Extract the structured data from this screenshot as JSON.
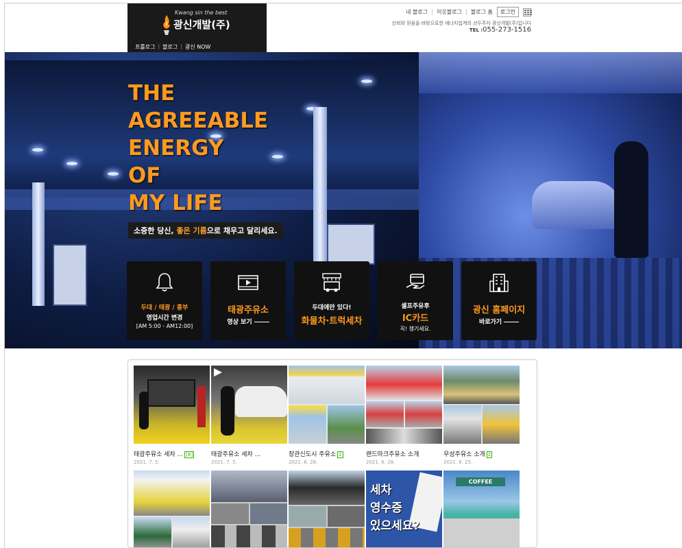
{
  "header": {
    "logo_sub": "Kwang sin the best",
    "logo_title": "광신개발(주)",
    "logo_nav": [
      "프롤로그",
      "블로그",
      "광신 NOW"
    ],
    "top_links": [
      "내 블로그",
      "이웃블로그",
      "블로그 홈"
    ],
    "login": "로그인",
    "tagline": "신뢰와 믿음을 바탕으로한 에너지업계의 선두주자 광신개발(주)입니다",
    "tel_label": "TEL :",
    "tel": "055-273-1516"
  },
  "hero": {
    "headline": [
      "THE",
      "AGREEABLE",
      "ENERGY",
      "OF",
      "MY LIFE"
    ],
    "sub_pre": "소중한 당신, ",
    "sub_em": "좋은 기름",
    "sub_post": "으로 채우고 달리세요.",
    "cards": [
      {
        "icon": "bell-icon",
        "t1": "두대 / 태광 / 흥부",
        "t2": "영업시간 변경",
        "t3": "[AM 5:00 - AM12:00]"
      },
      {
        "icon": "video-icon",
        "big": "태광주유소",
        "t2": "영상 보기"
      },
      {
        "icon": "truck-wash-icon",
        "t2": "두대에만 있다!",
        "big": "화물차·트럭세차"
      },
      {
        "icon": "card-hand-icon",
        "t2": "셀프주유후",
        "big": "IC카드",
        "t3": "꼭! 챙기세요."
      },
      {
        "icon": "building-icon",
        "big": "광신 홈페이지",
        "t2": "바로가기"
      }
    ]
  },
  "blog": {
    "posts": [
      {
        "title": "태광주유소 세차 ...",
        "badge": "[8]",
        "date": "2021. 7. 5."
      },
      {
        "title": "태광주유소 세차 ...",
        "badge": "",
        "date": "2021. 7. 5."
      },
      {
        "title": "창관신도시 주유소",
        "badge": "2",
        "date": "2021. 6. 28."
      },
      {
        "title": "랜드마크주유소 소개",
        "badge": "",
        "date": "2021. 6. 28."
      },
      {
        "title": "우성주유소 소개",
        "badge": "2",
        "date": "2021. 6. 25."
      },
      {
        "title": "",
        "badge": "",
        "date": ""
      },
      {
        "title": "",
        "badge": "",
        "date": ""
      },
      {
        "title": "",
        "badge": "",
        "date": ""
      },
      {
        "title": "",
        "badge": "",
        "date": "",
        "overlay": [
          "세차",
          "영수증",
          "있으세요?"
        ]
      },
      {
        "title": "",
        "badge": "",
        "date": "",
        "overlay_sign": "COFFEE"
      }
    ]
  },
  "colors": {
    "accent": "#ff9a1f",
    "naver_green": "#2db400",
    "card_bg": "#111111"
  }
}
